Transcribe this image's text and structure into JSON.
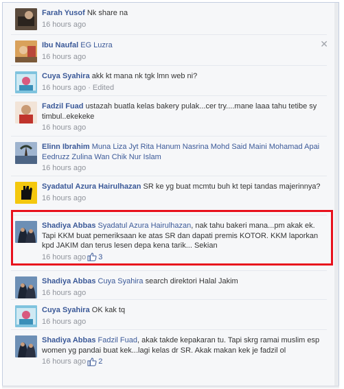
{
  "comments": [
    {
      "author": "Farah Yusof",
      "tags": "",
      "text": "Nk share na",
      "time": "16 hours ago",
      "edited": "",
      "likes": ""
    },
    {
      "author": "Ibu Naufal",
      "tags": "EG Luzra",
      "text": "",
      "time": "16 hours ago",
      "edited": "",
      "likes": ""
    },
    {
      "author": "Cuya Syahira",
      "tags": "",
      "text": "akk kt mana nk tgk lmn web ni?",
      "time": "16 hours ago",
      "edited": "Edited",
      "likes": ""
    },
    {
      "author": "Fadzil Fuad",
      "tags": "",
      "text": "ustazah buatla kelas bakery pulak...cer try....mane laaa tahu tetibe sy timbul..ekekeke",
      "time": "16 hours ago",
      "edited": "",
      "likes": ""
    },
    {
      "author": "Elinn Ibrahim",
      "tags": "Muna Liza Jyt Rita Hanum Nasrina Mohd Said Maini Mohamad Apai Eedruzz Zulina Wan Chik Nur Islam",
      "text": "",
      "time": "16 hours ago",
      "edited": "",
      "likes": ""
    },
    {
      "author": "Syadatul Azura Hairulhazan",
      "tags": "",
      "text": "SR ke yg buat mcmtu buh kt tepi tandas majerinnya?",
      "time": "16 hours ago",
      "edited": "",
      "likes": ""
    },
    {
      "author": "Shadiya Abbas",
      "tags": "Syadatul Azura Hairulhazan",
      "text": ", nak tahu bakeri mana...pm akak ek. Tapi KKM buat pemeriksaan ke atas SR dan dapati premis KOTOR. KKM laporkan kpd JAKIM dan terus lesen depa kena tarik... Sekian",
      "time": "16 hours ago",
      "edited": "",
      "likes": "3"
    },
    {
      "author": "Shadiya Abbas",
      "tags": "Cuya Syahira",
      "text": "search direktori Halal Jakim",
      "time": "16 hours ago",
      "edited": "",
      "likes": ""
    },
    {
      "author": "Cuya Syahira",
      "tags": "",
      "text": "OK kak tq",
      "time": "16 hours ago",
      "edited": "",
      "likes": ""
    },
    {
      "author": "Shadiya Abbas",
      "tags": "Fadzil Fuad",
      "text": ", akak takde kepakaran tu. Tapi skrg ramai muslim esp women yg pandai buat kek...lagi kelas dr SR. Akak makan kek je fadzil ol",
      "time": "16 hours ago",
      "edited": "",
      "likes": "2"
    }
  ],
  "icons": {
    "close": "close-icon",
    "like": "thumbs-up-icon"
  },
  "colors": {
    "link": "#3b5998",
    "meta": "#90949c",
    "highlight": "#e8101c"
  }
}
